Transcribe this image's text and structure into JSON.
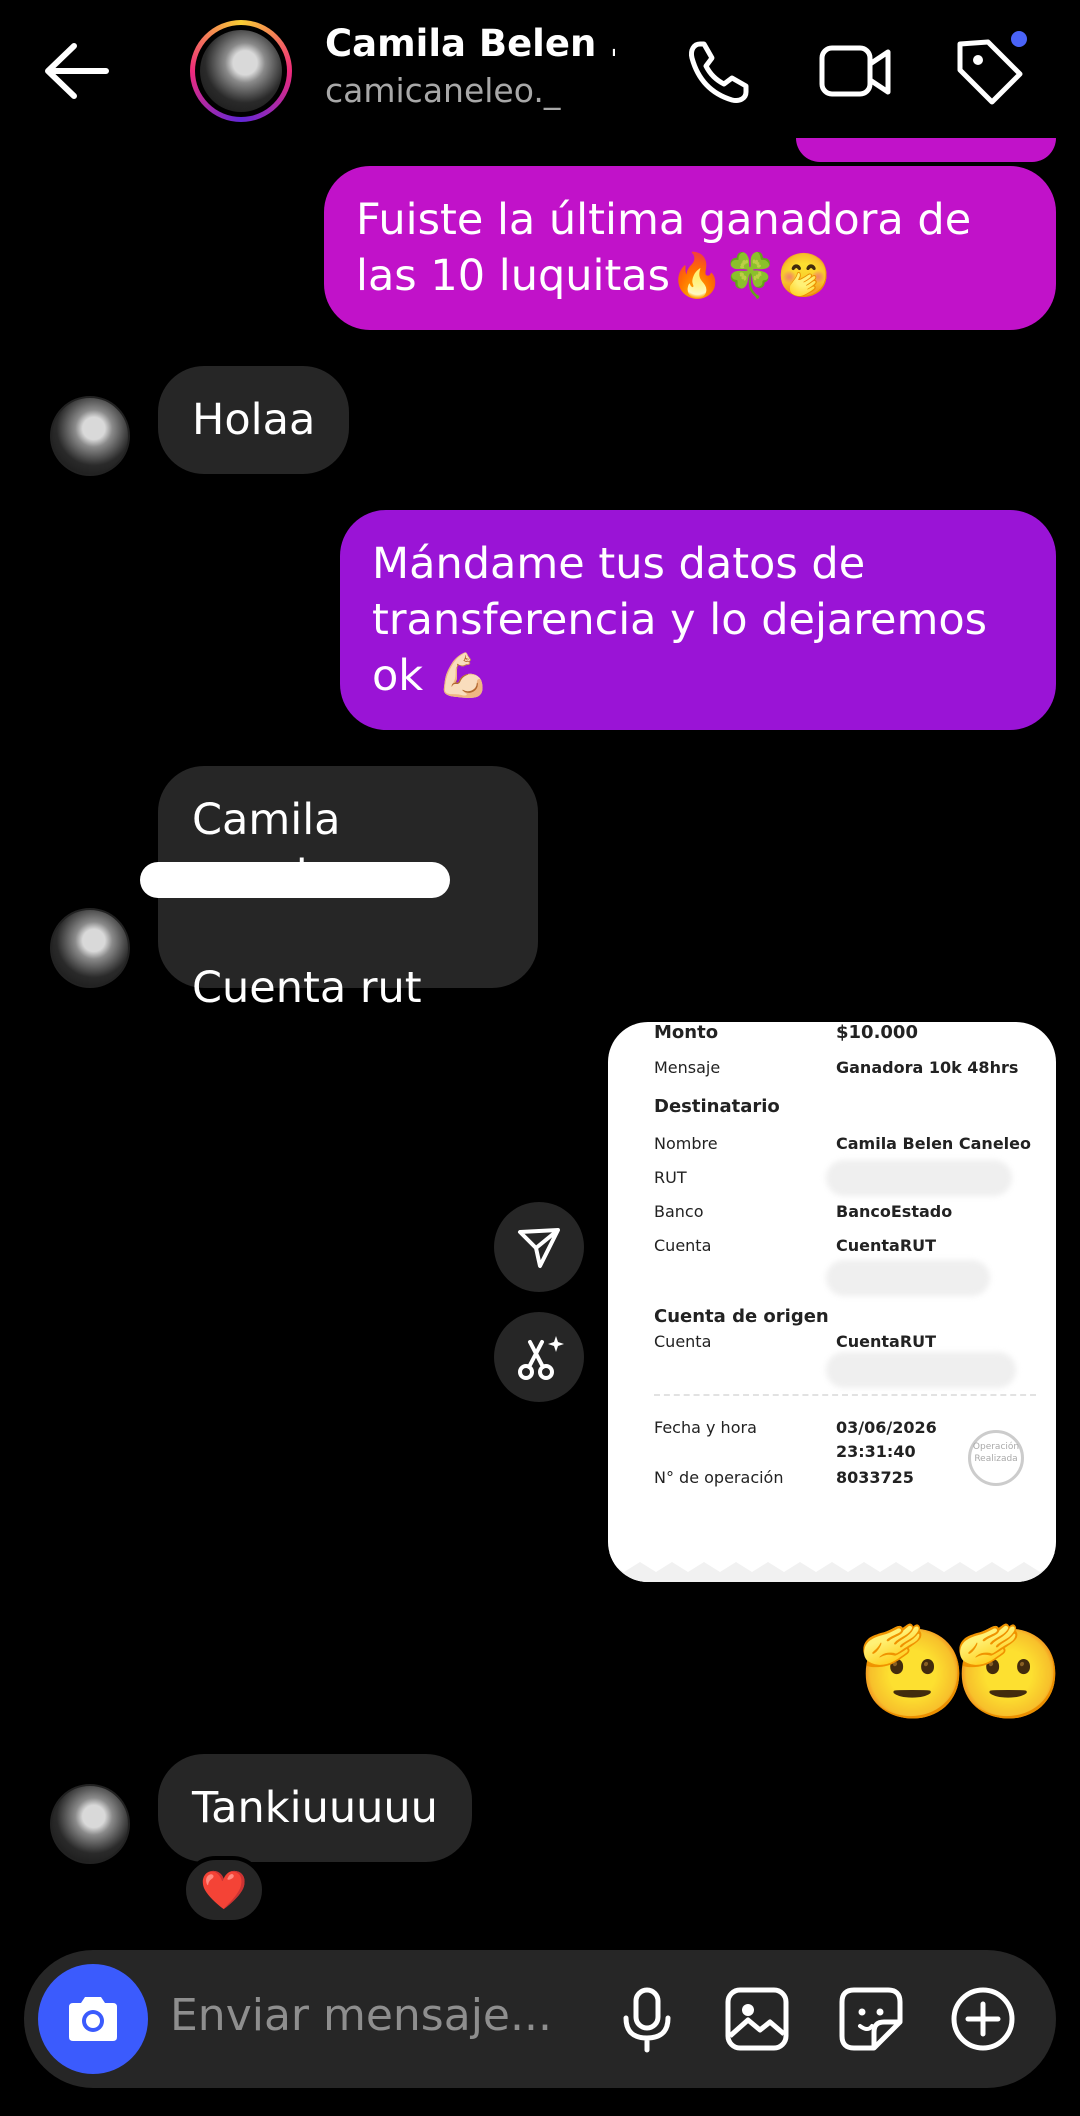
{
  "header": {
    "title": "Camila Belen ...",
    "username": "camicaneleo._"
  },
  "messages": {
    "out1": "Fuiste la última ganadora de las 10 luquitas🔥🍀🤭",
    "in1": "Holaa",
    "out2": "Mándame tus datos de transferencia y lo dejaremos ok 💪🏻",
    "in2_line1": "Camila caneleo",
    "in2_line2": "Cuenta rut",
    "emoji_reply_1": "🫡",
    "emoji_reply_2": "🫡",
    "in3": "Tankiuuuuu",
    "reaction": "❤️"
  },
  "receipt": {
    "monto_label": "Monto",
    "monto_value": "$10.000",
    "mensaje_label": "Mensaje",
    "mensaje_value": "Ganadora 10k 48hrs",
    "destinatario_heading": "Destinatario",
    "nombre_label": "Nombre",
    "nombre_value": "Camila Belen Caneleo",
    "rut_label": "RUT",
    "banco_label": "Banco",
    "banco_value": "BancoEstado",
    "cuenta_label": "Cuenta",
    "cuenta_value": "CuentaRUT",
    "origen_heading": "Cuenta de origen",
    "origen_cuenta_label": "Cuenta",
    "origen_cuenta_value": "CuentaRUT",
    "fecha_label": "Fecha y hora",
    "fecha_value": "03/06/2026",
    "hora_value": "23:31:40",
    "operacion_label": "N° de operación",
    "operacion_value": "8033725",
    "stamp_text": "Operación Realizada"
  },
  "composer": {
    "placeholder": "Enviar mensaje..."
  },
  "colors": {
    "bubble_out_1": "#c112c9",
    "bubble_out_2": "#9a14d6",
    "bubble_in": "#262626",
    "accent_blue": "#3b5bfd"
  }
}
